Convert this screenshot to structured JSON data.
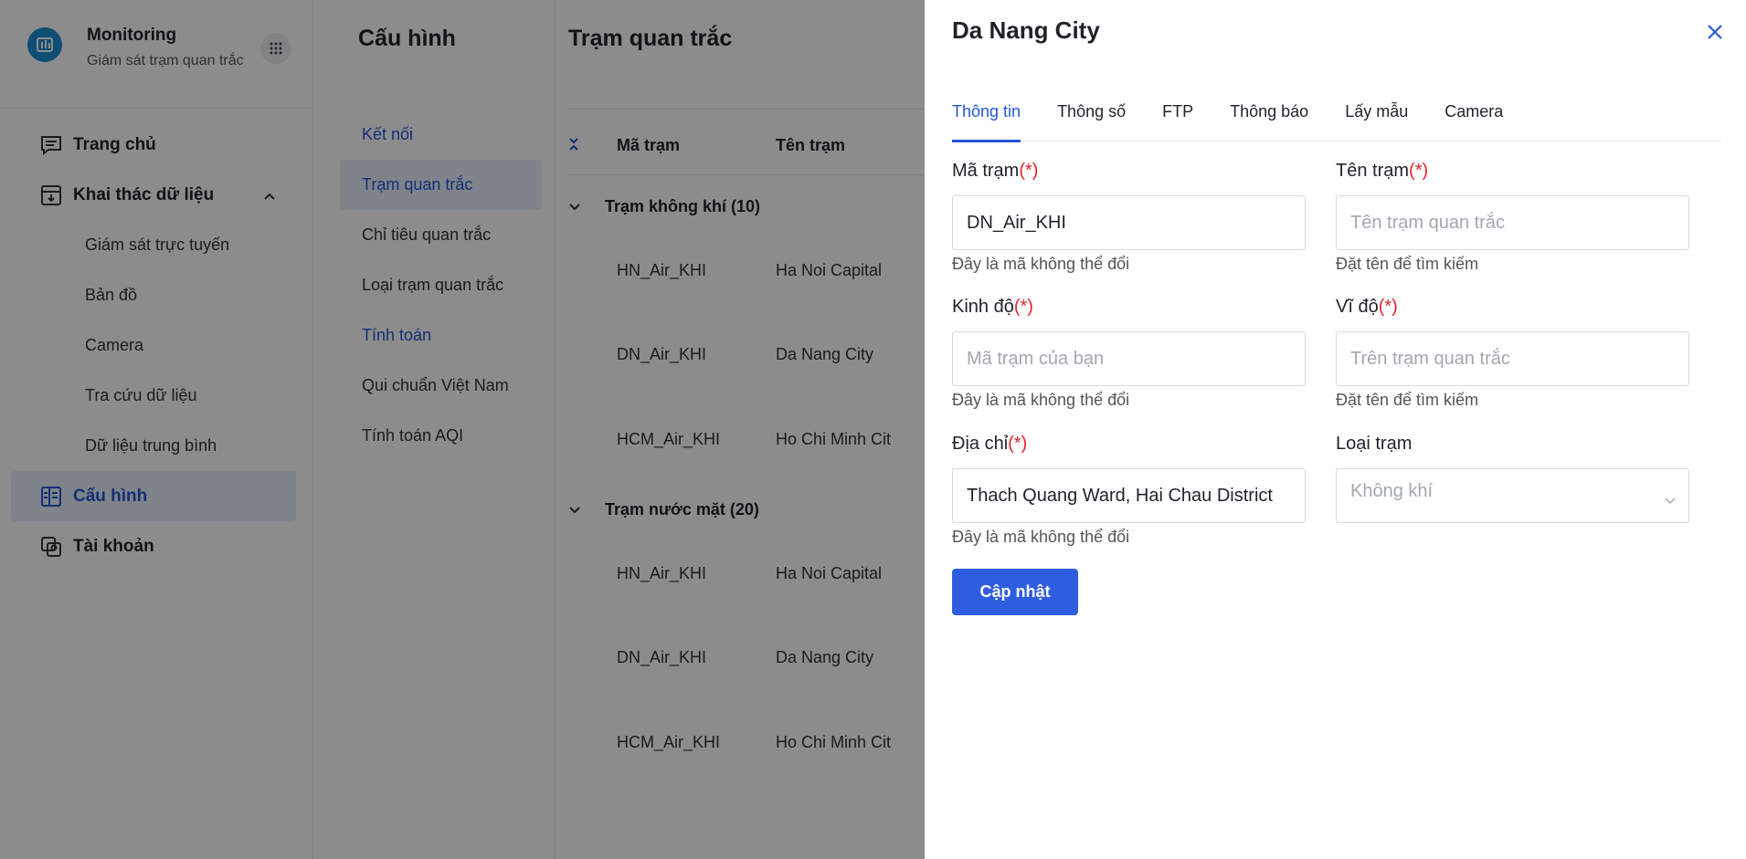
{
  "brand": {
    "title": "Monitoring",
    "subtitle": "Giám sát trạm quan trắc"
  },
  "sidebar": {
    "items": [
      {
        "label": "Trang chủ",
        "icon": "chat-icon"
      },
      {
        "label": "Khai thác dữ liệu",
        "icon": "download-box-icon",
        "expanded": true,
        "children": [
          "Giám sát trực tuyến",
          "Bản đồ",
          "Camera",
          "Tra cứu dữ liệu",
          "Dữ liệu trung bình"
        ]
      },
      {
        "label": "Cấu hình",
        "icon": "config-icon",
        "active": true
      },
      {
        "label": "Tài khoản",
        "icon": "account-icon"
      }
    ]
  },
  "config": {
    "title": "Cấu hình",
    "items": [
      {
        "label": "Kết nối",
        "kind": "section"
      },
      {
        "label": "Trạm quan trắc",
        "kind": "active"
      },
      {
        "label": "Chỉ tiêu quan trắc",
        "kind": "item"
      },
      {
        "label": "Loại trạm quan trắc",
        "kind": "item"
      },
      {
        "label": "Tính toán",
        "kind": "section"
      },
      {
        "label": "Qui chuẩn Việt Nam",
        "kind": "item"
      },
      {
        "label": "Tính toán AQI",
        "kind": "item"
      }
    ]
  },
  "table": {
    "title": "Trạm quan trắc",
    "columns": [
      "Mã trạm",
      "Tên trạm"
    ],
    "groups": [
      {
        "label": "Trạm không khí (10)",
        "rows": [
          [
            "HN_Air_KHI",
            "Ha Noi Capital"
          ],
          [
            "DN_Air_KHI",
            "Da Nang City"
          ],
          [
            "HCM_Air_KHI",
            "Ho Chi Minh Cit"
          ]
        ]
      },
      {
        "label": "Trạm nước mặt (20)",
        "rows": [
          [
            "HN_Air_KHI",
            "Ha Noi Capital"
          ],
          [
            "DN_Air_KHI",
            "Da Nang City"
          ],
          [
            "HCM_Air_KHI",
            "Ho Chi Minh Cit"
          ]
        ]
      }
    ]
  },
  "drawer": {
    "title": "Da Nang City",
    "tabs": [
      "Thông tin",
      "Thông số",
      "FTP",
      "Thông báo",
      "Lấy mẫu",
      "Camera"
    ],
    "active_tab": 0,
    "required_mark": "(*)",
    "fields": {
      "code": {
        "label": "Mã trạm",
        "value": "DN_Air_KHI",
        "hint": "Đây là mã không thể đổi"
      },
      "name": {
        "label": "Tên trạm",
        "placeholder": "Tên trạm quan trắc",
        "hint": "Đặt tên để tìm kiếm"
      },
      "lng": {
        "label": "Kinh độ",
        "placeholder": "Mã trạm của bạn",
        "hint": "Đây là mã không thể đổi"
      },
      "lat": {
        "label": "Vĩ độ",
        "placeholder": "Trên trạm quan trắc",
        "hint": "Đặt tên để tìm kiếm"
      },
      "address": {
        "label": "Địa chỉ",
        "value": "Thach Quang Ward, Hai Chau District",
        "hint": "Đây là mã không thể đổi"
      },
      "type": {
        "label": "Loại trạm",
        "placeholder": "Không khí"
      }
    },
    "submit_label": "Cập nhật"
  },
  "colors": {
    "accent": "#2557d6",
    "button": "#2f5de0",
    "required": "#e5242b",
    "overlay": "rgba(0,0,0,0.45)"
  }
}
